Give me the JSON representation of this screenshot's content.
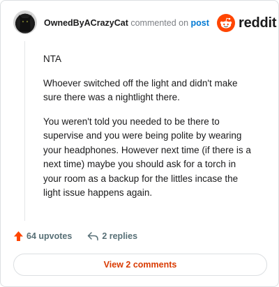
{
  "header": {
    "username": "OwnedByACrazyCat",
    "commented_text": "commented on",
    "post_link": "post",
    "logo_text": "reddit"
  },
  "comment": {
    "paragraphs": [
      "NTA",
      "Whoever switched off the light and didn't make sure there was a nightlight there.",
      "You weren't told you needed to be there to supervise and you were being polite by wearing your headphones. However next time (if there is a next time) maybe you should ask for a torch in your room as a backup for the littles incase the light issue happens again."
    ]
  },
  "actions": {
    "upvotes_label": "64 upvotes",
    "replies_label": "2 replies"
  },
  "footer": {
    "view_comments_label": "View 2 comments"
  },
  "colors": {
    "accent": "#d93a00",
    "upvote": "#ff4500",
    "link": "#0079d3"
  },
  "icons": {
    "avatar": "black-cat-avatar",
    "logo": "reddit-snoo-icon",
    "upvote": "upvote-arrow-icon",
    "reply": "reply-arrow-icon"
  }
}
